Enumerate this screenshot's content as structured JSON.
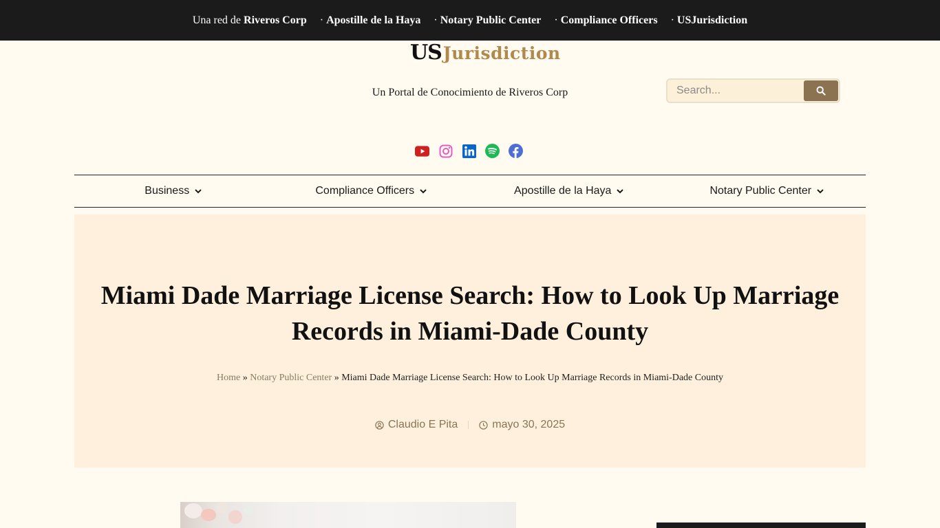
{
  "topbar": {
    "lead": "Una red de",
    "lead_brand": "Riveros Corp",
    "links": [
      "Apostille de la Haya",
      "Notary Public Center",
      "Compliance Officers",
      "USJurisdiction"
    ],
    "separator": "·"
  },
  "logo": {
    "part1": "US",
    "part2": "Jurisdiction"
  },
  "tagline": "Un Portal de Conocimiento de Riveros Corp",
  "search": {
    "placeholder": "Search...",
    "icon": "search-icon"
  },
  "socials": [
    {
      "name": "youtube-icon",
      "color": "#cd201f"
    },
    {
      "name": "instagram-icon",
      "color": "#e45cc4"
    },
    {
      "name": "linkedin-icon",
      "color": "#0a66c2"
    },
    {
      "name": "spotify-icon",
      "color": "#1db954"
    },
    {
      "name": "facebook-icon",
      "color": "#4d6fd1"
    }
  ],
  "nav": {
    "items": [
      {
        "label": "Business"
      },
      {
        "label": "Compliance Officers"
      },
      {
        "label": "Apostille de la Haya"
      },
      {
        "label": "Notary Public Center"
      }
    ]
  },
  "hero": {
    "title": "Miami Dade Marriage License Search: How to Look Up Marriage Records in Miami-Dade County",
    "breadcrumb": {
      "home": "Home",
      "sep": "»",
      "category": "Notary Public Center",
      "current": "Miami Dade Marriage License Search: How to Look Up Marriage Records in Miami-Dade County"
    },
    "author": "Claudio E Pita",
    "date": "mayo 30, 2025"
  },
  "colors": {
    "topbar": "#1b1b1b",
    "page_bg": "#fffbf0",
    "hero_bg": "#fef0dc",
    "accent": "#8b7250",
    "logo_gold": "#b0894e"
  }
}
